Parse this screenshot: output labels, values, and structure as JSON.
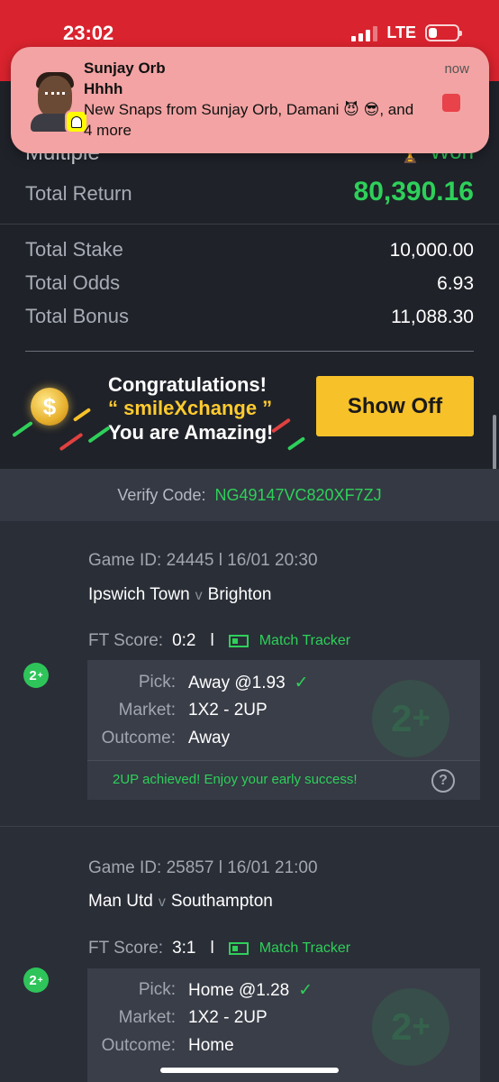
{
  "status_bar": {
    "time": "23:02",
    "network": "LTE"
  },
  "notification": {
    "sender": "Sunjay Orb",
    "subject": "Hhhh",
    "body": "New Snaps from Sunjay Orb, Damani 😈 😎, and 4 more",
    "time": "now",
    "app_icon": "snapchat-ghost-icon"
  },
  "bet": {
    "type": "Multiple",
    "status": "Won",
    "total_return_label": "Total Return",
    "total_return": "80,390.16",
    "total_stake_label": "Total Stake",
    "total_stake": "10,000.00",
    "total_odds_label": "Total Odds",
    "total_odds": "6.93",
    "total_bonus_label": "Total Bonus",
    "total_bonus": "11,088.30"
  },
  "promo": {
    "line1": "Congratulations!",
    "line2": "“ smileXchange ”",
    "line3": "You are Amazing!",
    "button": "Show Off",
    "coin_symbol": "$"
  },
  "verify": {
    "label": "Verify Code:",
    "code": "NG49147VC820XF7ZJ"
  },
  "games": [
    {
      "game_id_line": "Game ID: 24445 l 16/01 20:30",
      "home": "Ipswich Town",
      "vs": "v",
      "away": "Brighton",
      "ft_label": "FT Score:",
      "ft_score": "0:2",
      "separator": "l",
      "tracker": "Match Tracker",
      "badge": "2",
      "badge_sup": "+",
      "pick_label": "Pick:",
      "pick": "Away @1.93",
      "market_label": "Market:",
      "market": "1X2 - 2UP",
      "outcome_label": "Outcome:",
      "outcome": "Away",
      "achieved": "2UP achieved! Enjoy your early success!",
      "help": "?"
    },
    {
      "game_id_line": "Game ID: 25857 l 16/01 21:00",
      "home": "Man Utd",
      "vs": "v",
      "away": "Southampton",
      "ft_label": "FT Score:",
      "ft_score": "3:1",
      "separator": "l",
      "tracker": "Match Tracker",
      "badge": "2",
      "badge_sup": "+",
      "pick_label": "Pick:",
      "pick": "Home @1.28",
      "market_label": "Market:",
      "market": "1X2 - 2UP",
      "outcome_label": "Outcome:",
      "outcome": "Home"
    }
  ],
  "colors": {
    "status_red": "#d9232e",
    "win_green": "#2ed05a",
    "promo_yellow": "#f7c12a",
    "bg_dark": "#1f2229"
  }
}
